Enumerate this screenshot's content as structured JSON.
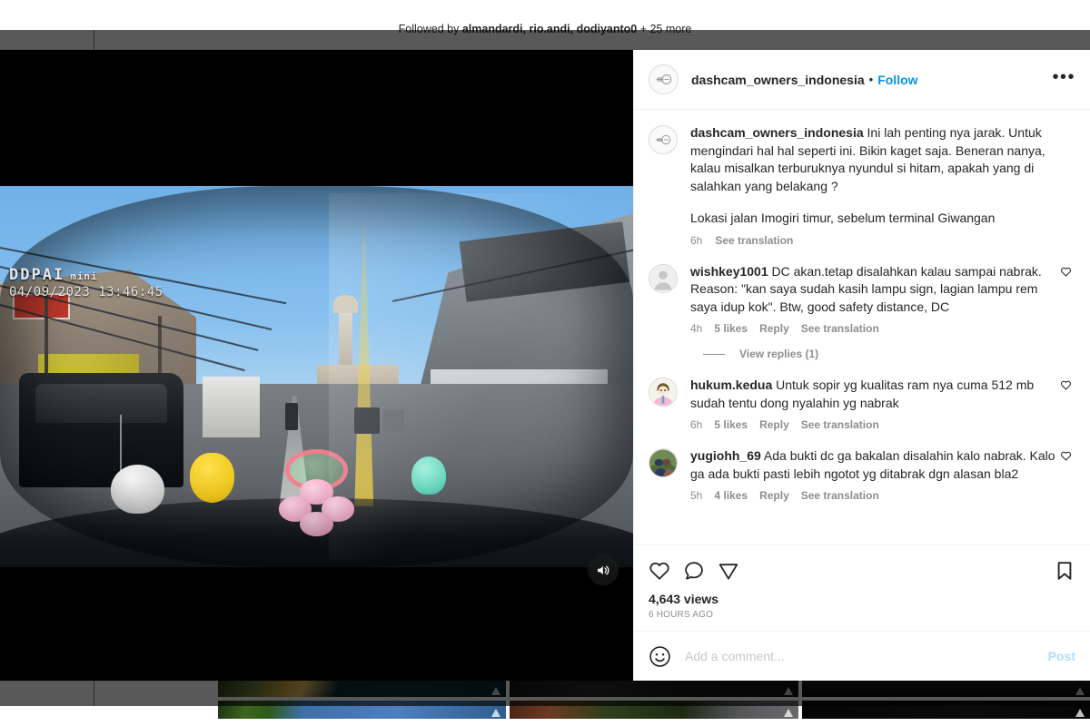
{
  "background": {
    "followed_by_prefix": "Followed by ",
    "followed_by_names": "almandardi, rio.andi, dodiyanto0",
    "followed_by_suffix": " + 25 more"
  },
  "post": {
    "header": {
      "username": "dashcam_owners_indonesia",
      "separator": "•",
      "follow_label": "Follow",
      "more_label": "•••",
      "avatar_name": "dashcam-owners-logo-avatar"
    },
    "media": {
      "watermark_brand": "DDPAI",
      "watermark_model": "mini",
      "watermark_timestamp": "04/09/2023  13:46:45",
      "sound_icon": "volume-on-icon"
    },
    "caption": {
      "username": "dashcam_owners_indonesia",
      "paragraph_1": "Ini lah penting nya jarak. Untuk mengindari hal hal seperti ini. Bikin kaget saja. Beneran nanya, kalau misalkan terburuknya nyundul si hitam, apakah yang di salahkan yang belakang ?",
      "paragraph_2": "Lokasi jalan Imogiri timur, sebelum terminal Giwangan",
      "time": "6h",
      "see_translation": "See translation"
    },
    "comments": [
      {
        "username": "wishkey1001",
        "text": "DC akan.tetap disalahkan kalau sampai nabrak. Reason: \"kan saya sudah kasih lampu sign, lagian lampu rem saya idup kok\". Btw, good safety distance, DC",
        "time": "4h",
        "likes": "5 likes",
        "reply": "Reply",
        "see_translation": "See translation",
        "view_replies": "View replies (1)",
        "avatar_type": "default-silhouette"
      },
      {
        "username": "hukum.kedua",
        "text": "Untuk sopir yg kualitas ram nya cuma 512 mb sudah tentu dong nyalahin yg nabrak",
        "time": "6h",
        "likes": "5 likes",
        "reply": "Reply",
        "see_translation": "See translation",
        "view_replies": null,
        "avatar_type": "cartoon-person"
      },
      {
        "username": "yugiohh_69",
        "text": "Ada bukti dc ga bakalan disalahin kalo nabrak. Kalo ga ada bukti pasti lebih ngotot yg ditabrak dgn alasan bla2",
        "time": "5h",
        "likes": "4 likes",
        "reply": "Reply",
        "see_translation": "See translation",
        "view_replies": null,
        "avatar_type": "couple-photo"
      }
    ],
    "actions": {
      "like_icon": "heart-icon",
      "comment_icon": "comment-bubble-icon",
      "share_icon": "share-paper-plane-icon",
      "bookmark_icon": "bookmark-icon",
      "views": "4,643 views",
      "posted_time": "6 HOURS AGO"
    },
    "composer": {
      "emoji_icon": "emoji-smiley-icon",
      "placeholder": "Add a comment...",
      "value": "",
      "post_label": "Post"
    }
  },
  "colors": {
    "accent_blue": "#0095f6",
    "post_disabled_blue": "#b3dcfe",
    "text_primary": "#262626",
    "text_secondary": "#8e8e8e",
    "border": "#efefef"
  }
}
